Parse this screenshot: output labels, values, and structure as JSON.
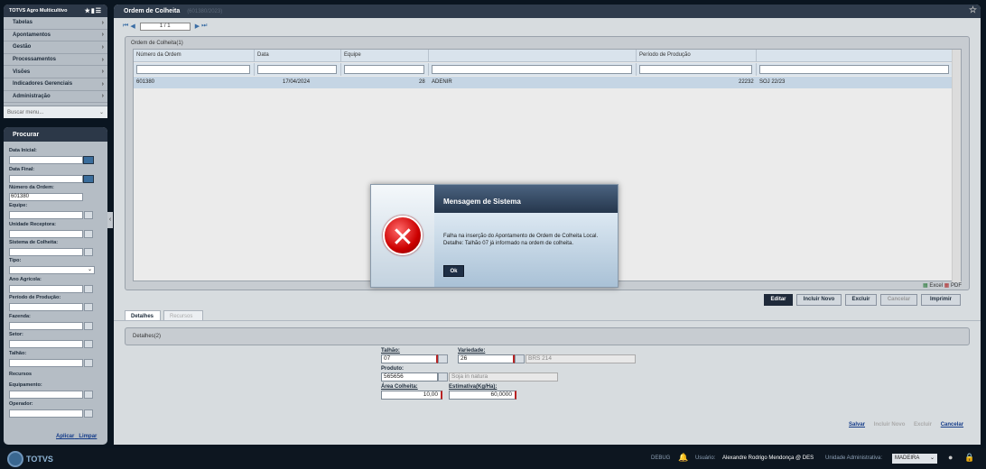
{
  "sidebar": {
    "app_title": "TOTVS Agro Multicultivo",
    "menu": [
      "Tabelas",
      "Apontamentos",
      "Gestão",
      "Processamentos",
      "Visões",
      "Indicadores Gerenciais",
      "Administração"
    ],
    "search_placeholder": "Buscar menu...",
    "find_title": "Procurar",
    "fields": {
      "data_inicial": "Data Inicial:",
      "data_final": "Data Final:",
      "numero_ordem": "Número da Ordem:",
      "numero_ordem_value": "601380",
      "equipe": "Equipe:",
      "unidade_receptora": "Unidade Receptora:",
      "sistema_colheita": "Sistema de Colheita:",
      "tipo": "Tipo:",
      "ano_agricola": "Ano Agrícola:",
      "periodo_producao": "Período de Produção:",
      "fazenda": "Fazenda:",
      "setor": "Setor:",
      "talhao": "Talhão:",
      "recursos": "Recursos",
      "equipamento": "Equipamento:",
      "operador": "Operador:"
    },
    "apply": "Aplicar",
    "clear": "Limpar"
  },
  "main": {
    "title": "Ordem de Colheita",
    "subtitle": "(601380/2023)",
    "pager": "1 / 1",
    "grid_title": "Ordem de Colheita(1)",
    "columns": [
      "Número da Ordem",
      "Data",
      "Equipe",
      "",
      "Período de Produção",
      ""
    ],
    "row": {
      "ordem": "601380",
      "data": "17/04/2024",
      "equipe_cod": "28",
      "equipe_nome": "ADENIR",
      "periodo_cod": "22232",
      "periodo_nome": "SOJ 22/23"
    },
    "export_excel": "Excel",
    "export_pdf": "PDF",
    "buttons": {
      "editar": "Editar",
      "incluir": "Incluir Novo",
      "excluir": "Excluir",
      "cancelar": "Cancelar",
      "imprimir": "Imprimir"
    },
    "tabs": {
      "detalhes": "Detalhes",
      "recursos": "Recursos"
    },
    "detail_title": "Detalhes(2)",
    "detail": {
      "talhao_label": "Talhão:",
      "talhao_value": "07",
      "variedade_label": "Variedade:",
      "variedade_value": "26",
      "variedade_desc": "BRS 214",
      "produto_label": "Produto:",
      "produto_value": "565656",
      "produto_desc": "Soja in natura",
      "area_label": "Área Colheita:",
      "area_value": "10,00",
      "estimativa_label": "Estimativa(Kg/Ha):",
      "estimativa_value": "60,0000"
    },
    "actions": {
      "salvar": "Salvar",
      "incluir_novo": "Incluir Novo",
      "excluir": "Excluir",
      "cancelar": "Cancelar"
    }
  },
  "footer": {
    "brand": "TOTVS",
    "debug": "DEBUG",
    "user_label": "Usuário:",
    "user_value": "Alexandre Rodrigo Mendonça @ DES",
    "unit_label": "Unidade Administrativa:",
    "unit_value": "MADEIRA"
  },
  "modal": {
    "title": "Mensagem de Sistema",
    "line1": "Falha na inserção do Apontamento de Ordem de Colheita Local.",
    "line2": "Detalhe: Talhão 07 já informado na ordem de colheita.",
    "ok": "Ok"
  }
}
